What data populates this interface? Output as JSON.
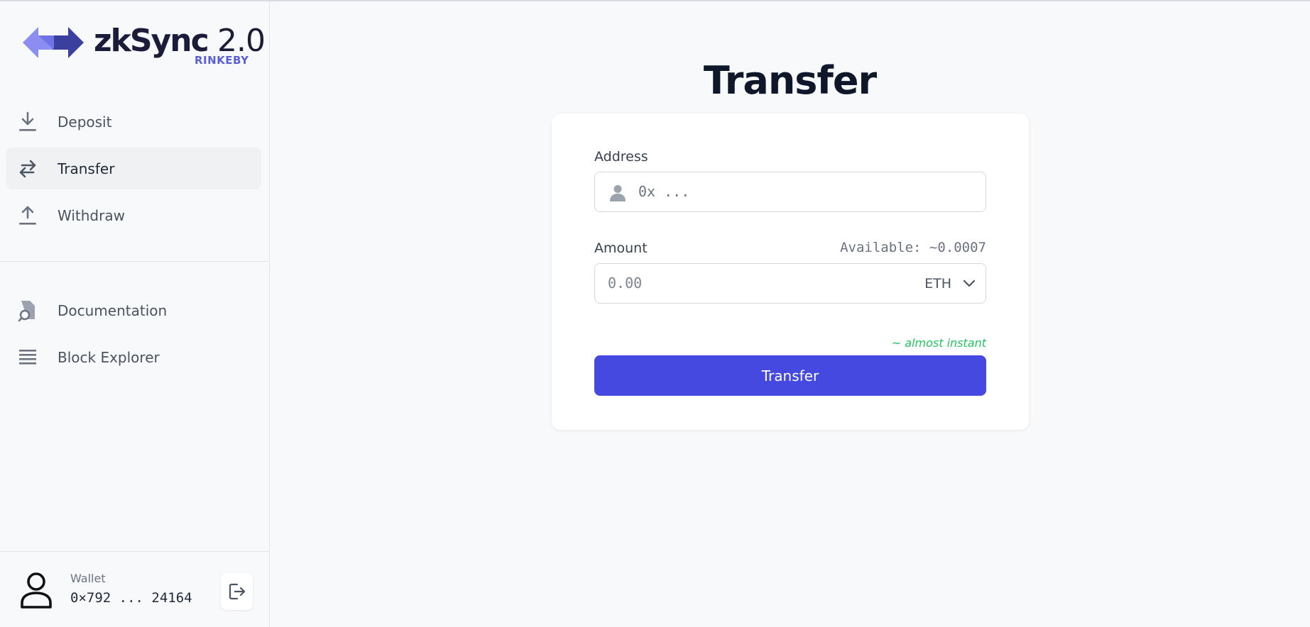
{
  "brand": {
    "name": "zkSync",
    "version": "2.0",
    "network": "RINKEBY"
  },
  "sidebar": {
    "nav": [
      {
        "label": "Deposit",
        "icon": "download-icon"
      },
      {
        "label": "Transfer",
        "icon": "transfer-arrows-icon",
        "active": true
      },
      {
        "label": "Withdraw",
        "icon": "upload-icon"
      }
    ],
    "links": [
      {
        "label": "Documentation",
        "icon": "document-search-icon"
      },
      {
        "label": "Block Explorer",
        "icon": "list-icon"
      }
    ],
    "wallet": {
      "label": "Wallet",
      "address": "0×792 ... 24164"
    }
  },
  "main": {
    "title": "Transfer",
    "address_label": "Address",
    "address_placeholder": "0x ...",
    "amount_label": "Amount",
    "available": "Available: ~0.0007",
    "amount_placeholder": "0.00",
    "token": "ETH",
    "speed_note": "~ almost instant",
    "submit_label": "Transfer"
  },
  "colors": {
    "accent": "#4549e0",
    "network": "#5a5fd6",
    "speed": "#22c55e"
  }
}
